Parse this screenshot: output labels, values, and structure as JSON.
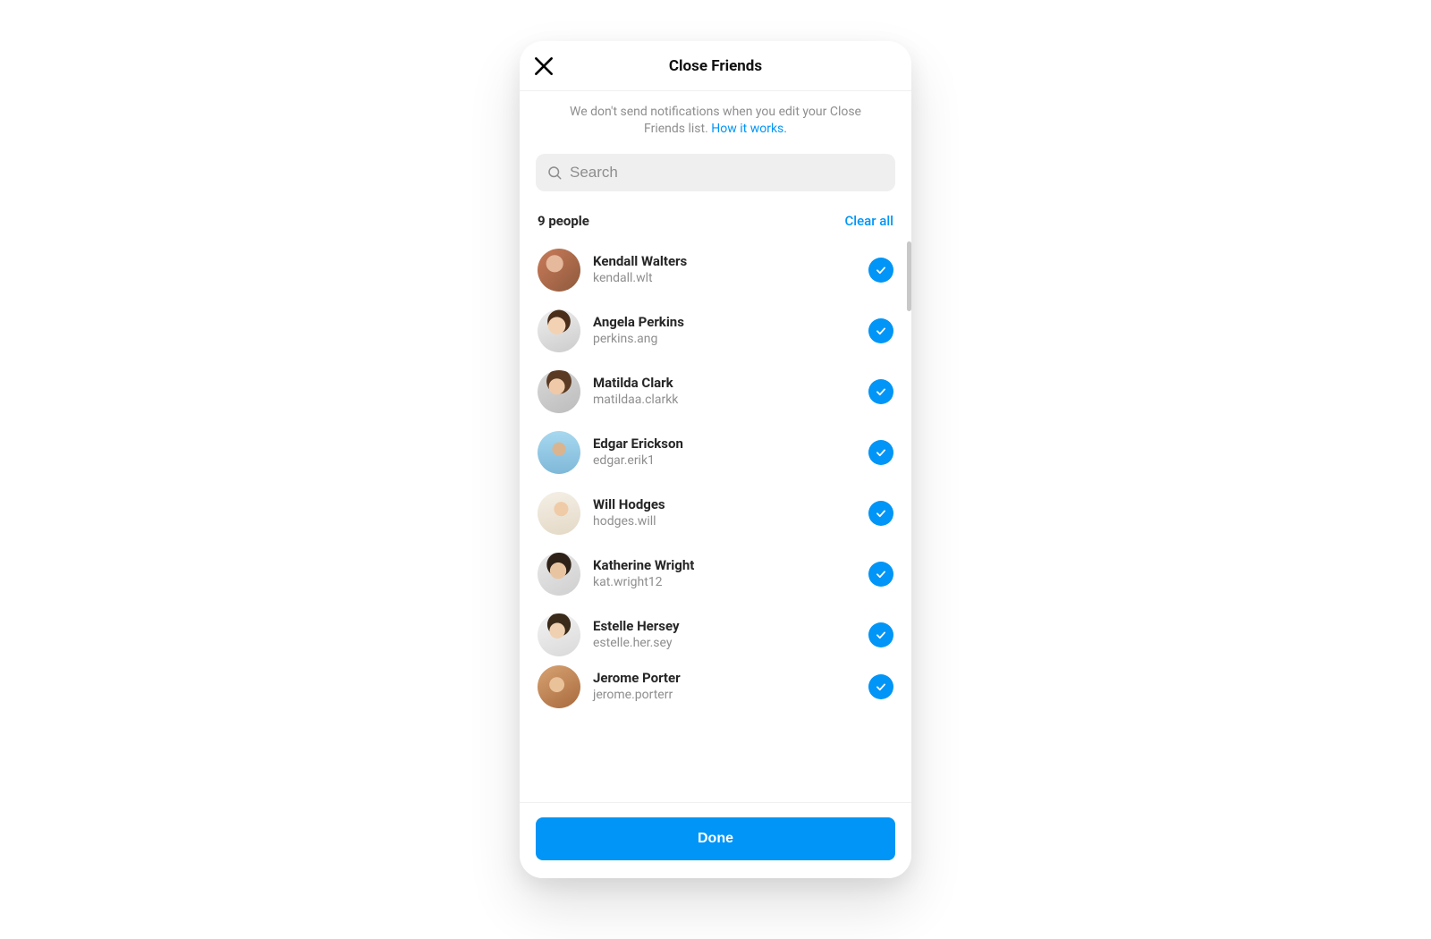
{
  "header": {
    "title": "Close Friends"
  },
  "info": {
    "text": "We don't send notifications when you edit your Close Friends list. ",
    "link": "How it works."
  },
  "search": {
    "placeholder": "Search",
    "value": ""
  },
  "count_row": {
    "count": "9 people",
    "clear": "Clear all"
  },
  "done_label": "Done",
  "people": [
    {
      "name": "Kendall Walters",
      "username": "kendall.wlt"
    },
    {
      "name": "Angela Perkins",
      "username": "perkins.ang"
    },
    {
      "name": "Matilda Clark",
      "username": "matildaa.clarkk"
    },
    {
      "name": "Edgar Erickson",
      "username": "edgar.erik1"
    },
    {
      "name": "Will Hodges",
      "username": "hodges.will"
    },
    {
      "name": "Katherine Wright",
      "username": "kat.wright12"
    },
    {
      "name": "Estelle Hersey",
      "username": "estelle.her.sey"
    },
    {
      "name": "Jerome Porter",
      "username": "jerome.porterr"
    }
  ]
}
